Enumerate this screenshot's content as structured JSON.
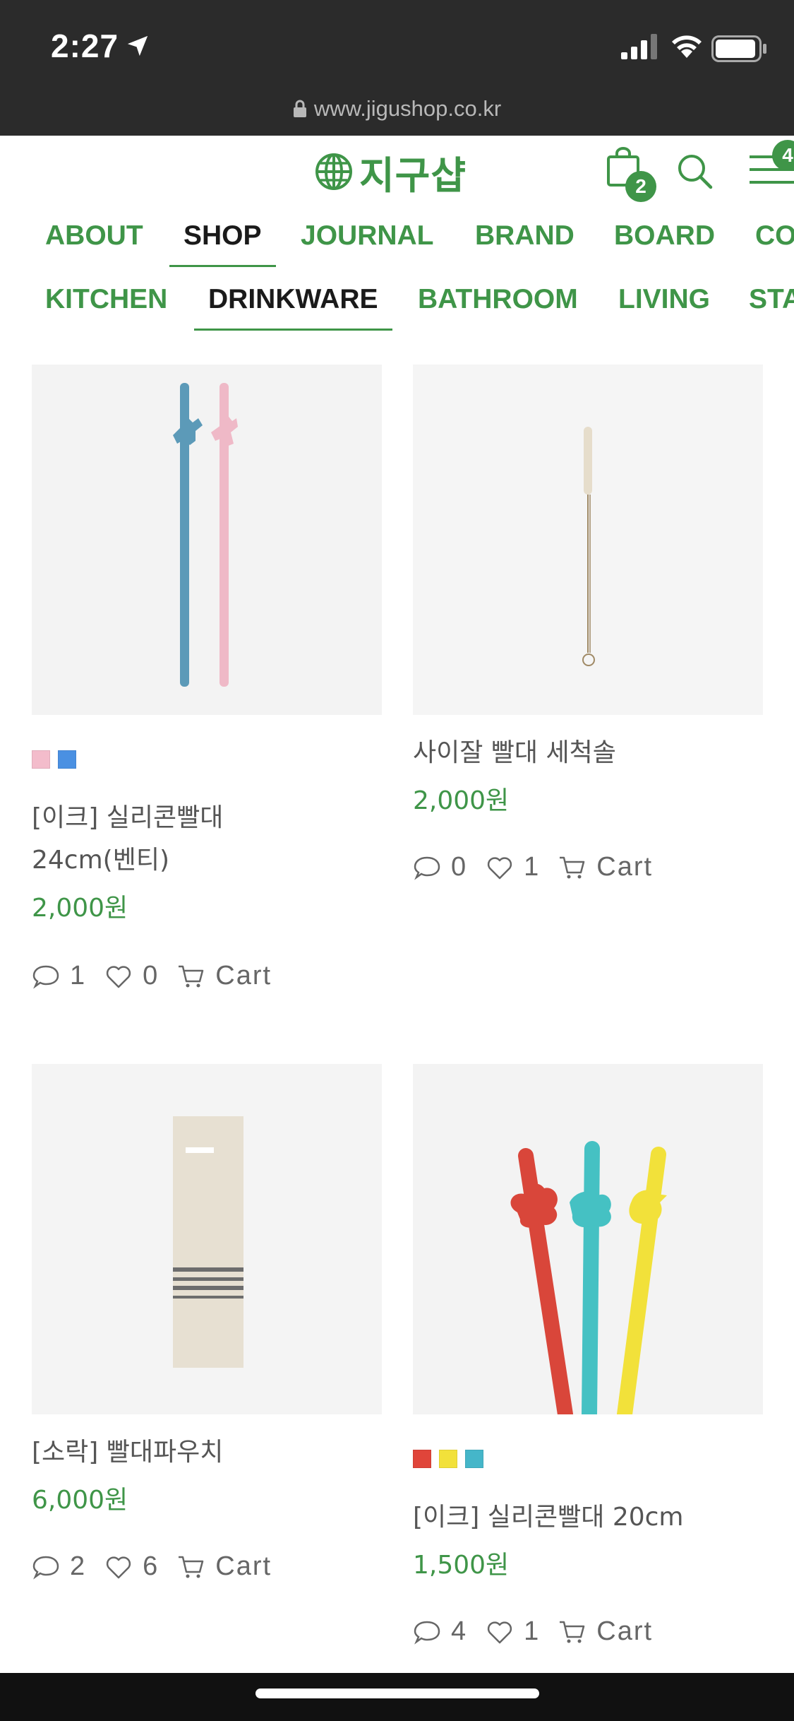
{
  "status_bar": {
    "time": "2:27",
    "url": "www.jigushop.co.kr"
  },
  "header": {
    "logo_text": "지구샵",
    "bag_count": "2",
    "menu_count": "4"
  },
  "nav": {
    "main": [
      {
        "label": "ABOUT"
      },
      {
        "label": "SHOP"
      },
      {
        "label": "JOURNAL"
      },
      {
        "label": "BRAND"
      },
      {
        "label": "BOARD"
      },
      {
        "label": "CO"
      }
    ],
    "sub": [
      {
        "label": "KITCHEN"
      },
      {
        "label": "DRINKWARE"
      },
      {
        "label": "BATHROOM"
      },
      {
        "label": "LIVING"
      },
      {
        "label": "STA"
      }
    ]
  },
  "colors": {
    "accent": "#3f9548",
    "swatch_pink": "#f3bccb",
    "swatch_blue": "#4a90e2",
    "swatch_red": "#e0453a",
    "swatch_yellow": "#f2e13a",
    "swatch_teal": "#45b6c9"
  },
  "products": [
    {
      "name_line1": "[이크] 실리콘빨대",
      "name_line2": "24cm(벤티)",
      "price": "2,000원",
      "comments": "1",
      "likes": "0",
      "cart": "Cart"
    },
    {
      "name_line1": "사이잘 빨대 세척솔",
      "price": "2,000원",
      "comments": "0",
      "likes": "1",
      "cart": "Cart"
    },
    {
      "name_line1": "[소락] 빨대파우치",
      "price": "6,000원",
      "comments": "2",
      "likes": "6",
      "cart": "Cart"
    },
    {
      "name_line1": "[이크] 실리콘빨대 20cm",
      "price": "1,500원",
      "comments": "4",
      "likes": "1",
      "cart": "Cart"
    }
  ]
}
